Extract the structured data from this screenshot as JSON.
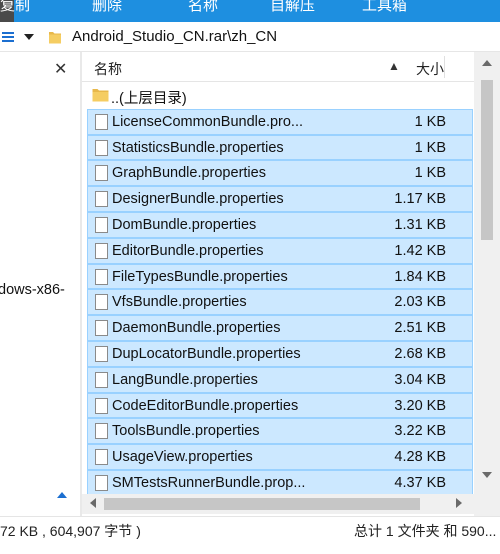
{
  "toolbar": {
    "items": [
      "复制",
      "删除",
      "名称",
      "自解压",
      "工具箱"
    ]
  },
  "address": {
    "path": "Android_Studio_CN.rar\\zh_CN"
  },
  "navpane": {
    "close_glyph": "✕",
    "visible_text": "dows-x86-"
  },
  "list": {
    "header": {
      "name": "名称",
      "size": "大小",
      "sort_glyph": "▲"
    },
    "parent": {
      "name": "..(上层目录)"
    },
    "files": [
      {
        "name": "LicenseCommonBundle.pro...",
        "size": "1 KB"
      },
      {
        "name": "StatisticsBundle.properties",
        "size": "1 KB"
      },
      {
        "name": "GraphBundle.properties",
        "size": "1 KB"
      },
      {
        "name": "DesignerBundle.properties",
        "size": "1.17 KB"
      },
      {
        "name": "DomBundle.properties",
        "size": "1.31 KB"
      },
      {
        "name": "EditorBundle.properties",
        "size": "1.42 KB"
      },
      {
        "name": "FileTypesBundle.properties",
        "size": "1.84 KB"
      },
      {
        "name": "VfsBundle.properties",
        "size": "2.03 KB"
      },
      {
        "name": "DaemonBundle.properties",
        "size": "2.51 KB"
      },
      {
        "name": "DupLocatorBundle.properties",
        "size": "2.68 KB"
      },
      {
        "name": "LangBundle.properties",
        "size": "3.04 KB"
      },
      {
        "name": "CodeEditorBundle.properties",
        "size": "3.20 KB"
      },
      {
        "name": "ToolsBundle.properties",
        "size": "3.22 KB"
      },
      {
        "name": "UsageView.properties",
        "size": "4.28 KB"
      },
      {
        "name": "SMTestsRunnerBundle.prop...",
        "size": "4.37 KB"
      }
    ]
  },
  "status": {
    "left": "72 KB , 604,907 字节 )",
    "right": "总计 1 文件夹 和 590..."
  }
}
